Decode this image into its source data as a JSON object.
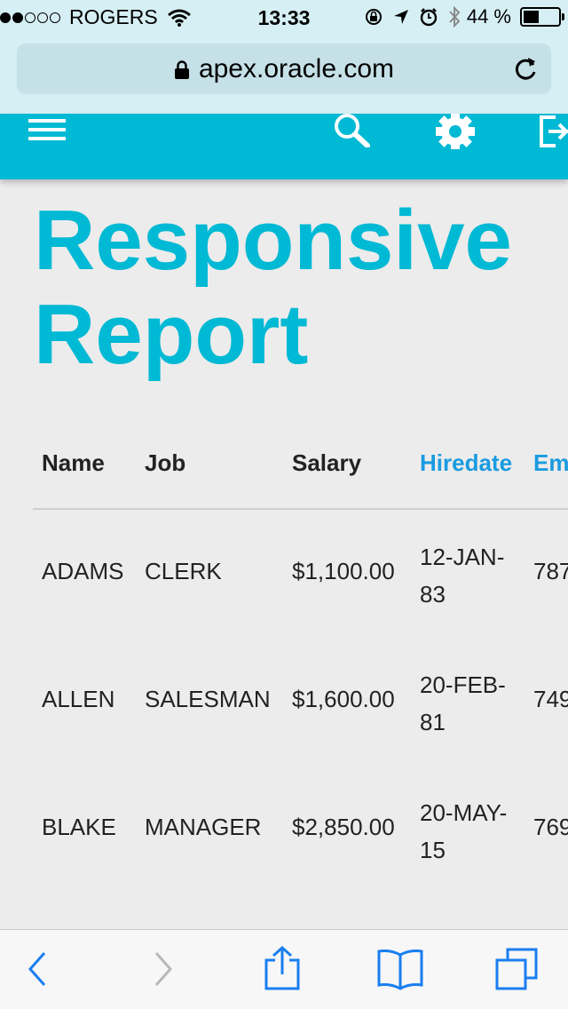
{
  "status_bar": {
    "carrier": "ROGERS",
    "signal_strength": 2,
    "time": "13:33",
    "battery_text": "44 %",
    "battery_level": 0.44
  },
  "browser": {
    "url": "apex.oracle.com"
  },
  "page": {
    "title": "Responsive Report"
  },
  "report": {
    "columns": [
      "Name",
      "Job",
      "Salary",
      "Hiredate",
      "Em"
    ],
    "rows": [
      {
        "name": "ADAMS",
        "job": "CLERK",
        "salary": "$1,100.00",
        "hiredate": "12-JAN-83",
        "emp": "787"
      },
      {
        "name": "ALLEN",
        "job": "SALESMAN",
        "salary": "$1,600.00",
        "hiredate": "20-FEB-81",
        "emp": "749"
      },
      {
        "name": "BLAKE",
        "job": "MANAGER",
        "salary": "$2,850.00",
        "hiredate": "20-MAY-15",
        "emp": "769"
      }
    ]
  },
  "colors": {
    "accent": "#00b9d4",
    "link": "#1a9be0",
    "ios_blue": "#1a7ef0"
  }
}
